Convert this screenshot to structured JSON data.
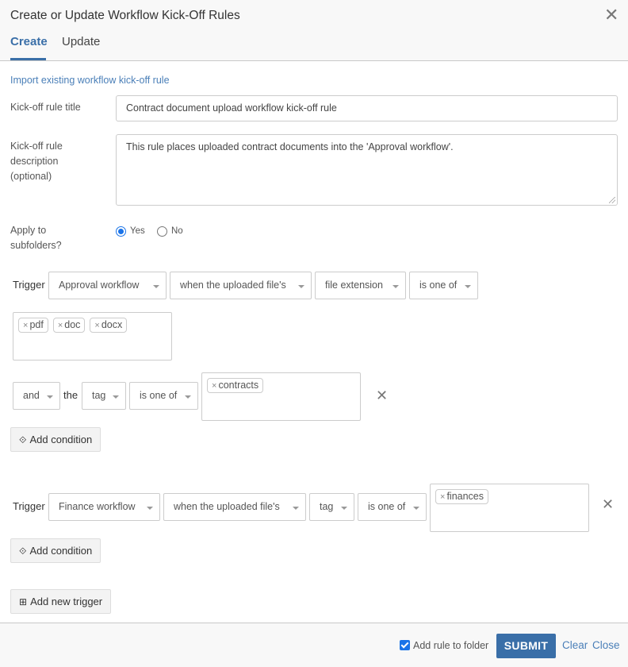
{
  "dialog": {
    "title": "Create or Update Workflow Kick-Off Rules",
    "close_icon": "close-icon",
    "tabs": [
      {
        "label": "Create",
        "active": true
      },
      {
        "label": "Update",
        "active": false
      }
    ]
  },
  "form": {
    "import_link": "Import existing workflow kick-off rule",
    "title_label": "Kick-off rule title",
    "title_value": "Contract document upload workflow kick-off rule",
    "description_label_lines": [
      "Kick-off rule",
      "description",
      "(optional)"
    ],
    "description_value": "This rule places uploaded contract documents into the 'Approval workflow'.",
    "subfolders_label_lines": [
      "Apply to",
      "subfolders?"
    ],
    "subfolders_options": [
      {
        "label": "Yes",
        "checked": true
      },
      {
        "label": "No",
        "checked": false
      }
    ]
  },
  "triggers": [
    {
      "label": "Trigger",
      "workflow": "Approval workflow",
      "subject": "when the uploaded file's",
      "attribute": "file extension",
      "operator": "is one of",
      "values": [
        "pdf",
        "doc",
        "docx"
      ],
      "conditions": [
        {
          "conjunction": "and",
          "the_label": "the",
          "attribute": "tag",
          "operator": "is one of",
          "values": [
            "contracts"
          ]
        }
      ],
      "add_condition_label": "Add condition"
    },
    {
      "label": "Trigger",
      "workflow": "Finance workflow",
      "subject": "when the uploaded file's",
      "attribute": "tag",
      "operator": "is one of",
      "values": [
        "finances"
      ],
      "add_condition_label": "Add condition"
    }
  ],
  "add_trigger_label": "Add new trigger",
  "footer": {
    "add_to_folder_label": "Add rule to folder",
    "add_to_folder_checked": true,
    "submit_label": "SUBMIT",
    "clear_label": "Clear",
    "close_label": "Close"
  },
  "colors": {
    "accent": "#3a6fa8",
    "link": "#4a7fb8",
    "radio_checked": "#1a73e8"
  },
  "chip_remove_glyph": "×"
}
